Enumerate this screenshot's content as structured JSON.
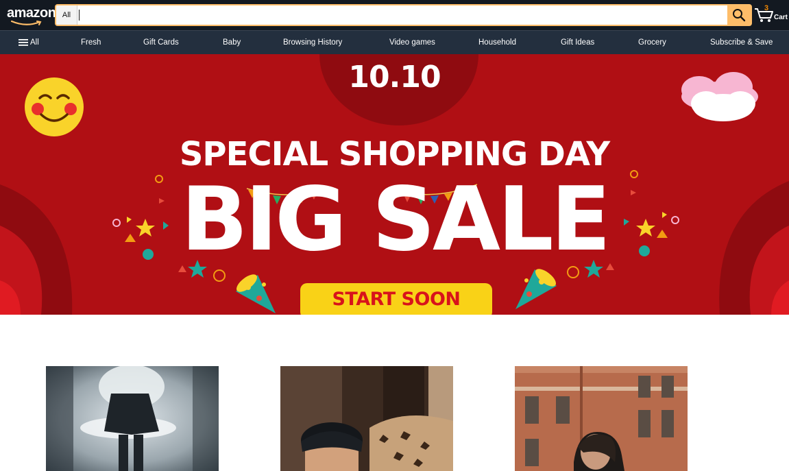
{
  "header": {
    "logo_text": "amazon",
    "search_category": "All",
    "search_value": "",
    "search_icon": "search-icon",
    "cart_count": "3",
    "cart_label": "Cart"
  },
  "nav": {
    "menu_label": "All",
    "items": [
      "Fresh",
      "Gift Cards",
      "Baby",
      "Browsing History",
      "Video games",
      "Household",
      "Gift Ideas",
      "Grocery",
      "Subscribe & Save"
    ]
  },
  "banner": {
    "date": "10.10",
    "line1": "SPECIAL SHOPPING DAY",
    "line2": "BIG SALE",
    "cta": "START SOON"
  },
  "colors": {
    "header_bg": "#131921",
    "nav_bg": "#232f3e",
    "accent": "#febd69",
    "banner_red": "#b00f14",
    "cta_yellow": "#f9d217"
  }
}
